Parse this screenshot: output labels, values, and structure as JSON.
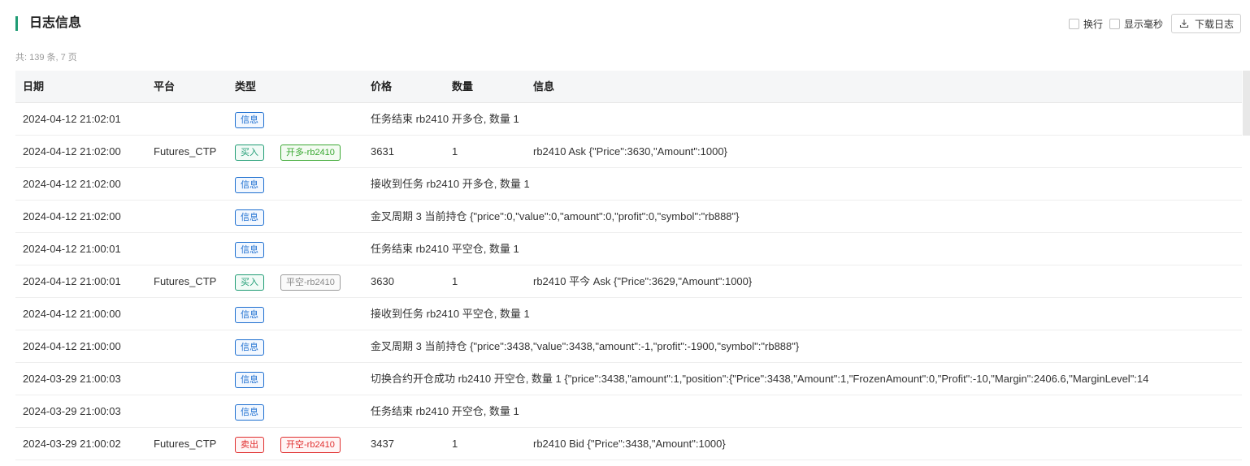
{
  "panel": {
    "title": "日志信息",
    "wrap_label": "换行",
    "ms_label": "显示毫秒",
    "download_label": "下载日志",
    "summary": "共: 139 条, 7 页"
  },
  "columns": {
    "date": "日期",
    "platform": "平台",
    "type": "类型",
    "price": "价格",
    "quantity": "数量",
    "info": "信息"
  },
  "rows": [
    {
      "date": "2024-04-12 21:02:01",
      "platform": "",
      "type": "信息",
      "type_style": "info",
      "tag2": "",
      "tag2_style": "",
      "price": "",
      "qty": "",
      "info": "任务结束 rb2410 开多仓, 数量 1"
    },
    {
      "date": "2024-04-12 21:02:00",
      "platform": "Futures_CTP",
      "type": "买入",
      "type_style": "buy",
      "tag2": "开多-rb2410",
      "tag2_style": "green2",
      "price": "3631",
      "qty": "1",
      "info": "rb2410 Ask {\"Price\":3630,\"Amount\":1000}"
    },
    {
      "date": "2024-04-12 21:02:00",
      "platform": "",
      "type": "信息",
      "type_style": "info",
      "tag2": "",
      "tag2_style": "",
      "price": "",
      "qty": "",
      "info": "接收到任务 rb2410 开多仓, 数量 1"
    },
    {
      "date": "2024-04-12 21:02:00",
      "platform": "",
      "type": "信息",
      "type_style": "info",
      "tag2": "",
      "tag2_style": "",
      "price": "",
      "qty": "",
      "info": "金叉周期 3 当前持仓 {\"price\":0,\"value\":0,\"amount\":0,\"profit\":0,\"symbol\":\"rb888\"}"
    },
    {
      "date": "2024-04-12 21:00:01",
      "platform": "",
      "type": "信息",
      "type_style": "info",
      "tag2": "",
      "tag2_style": "",
      "price": "",
      "qty": "",
      "info": "任务结束 rb2410 平空仓, 数量 1"
    },
    {
      "date": "2024-04-12 21:00:01",
      "platform": "Futures_CTP",
      "type": "买入",
      "type_style": "buy",
      "tag2": "平空-rb2410",
      "tag2_style": "gray",
      "price": "3630",
      "qty": "1",
      "info": "rb2410 平今 Ask {\"Price\":3629,\"Amount\":1000}"
    },
    {
      "date": "2024-04-12 21:00:00",
      "platform": "",
      "type": "信息",
      "type_style": "info",
      "tag2": "",
      "tag2_style": "",
      "price": "",
      "qty": "",
      "info": "接收到任务 rb2410 平空仓, 数量 1"
    },
    {
      "date": "2024-04-12 21:00:00",
      "platform": "",
      "type": "信息",
      "type_style": "info",
      "tag2": "",
      "tag2_style": "",
      "price": "",
      "qty": "",
      "info": "金叉周期 3 当前持仓 {\"price\":3438,\"value\":3438,\"amount\":-1,\"profit\":-1900,\"symbol\":\"rb888\"}"
    },
    {
      "date": "2024-03-29 21:00:03",
      "platform": "",
      "type": "信息",
      "type_style": "info",
      "tag2": "",
      "tag2_style": "",
      "price": "",
      "qty": "",
      "info": "切换合约开仓成功 rb2410 开空仓, 数量 1 {\"price\":3438,\"amount\":1,\"position\":{\"Price\":3438,\"Amount\":1,\"FrozenAmount\":0,\"Profit\":-10,\"Margin\":2406.6,\"MarginLevel\":14"
    },
    {
      "date": "2024-03-29 21:00:03",
      "platform": "",
      "type": "信息",
      "type_style": "info",
      "tag2": "",
      "tag2_style": "",
      "price": "",
      "qty": "",
      "info": "任务结束 rb2410 开空仓, 数量 1"
    },
    {
      "date": "2024-03-29 21:00:02",
      "platform": "Futures_CTP",
      "type": "卖出",
      "type_style": "sell",
      "tag2": "开空-rb2410",
      "tag2_style": "red2",
      "price": "3437",
      "qty": "1",
      "info": "rb2410 Bid {\"Price\":3438,\"Amount\":1000}"
    }
  ],
  "colors": {
    "accent": "#1f9c74",
    "info_tag": "#1e6fd0",
    "buy_tag": "#1f9c74",
    "sell_tag": "#e02f2f"
  },
  "icons": {
    "download": "download-icon"
  }
}
